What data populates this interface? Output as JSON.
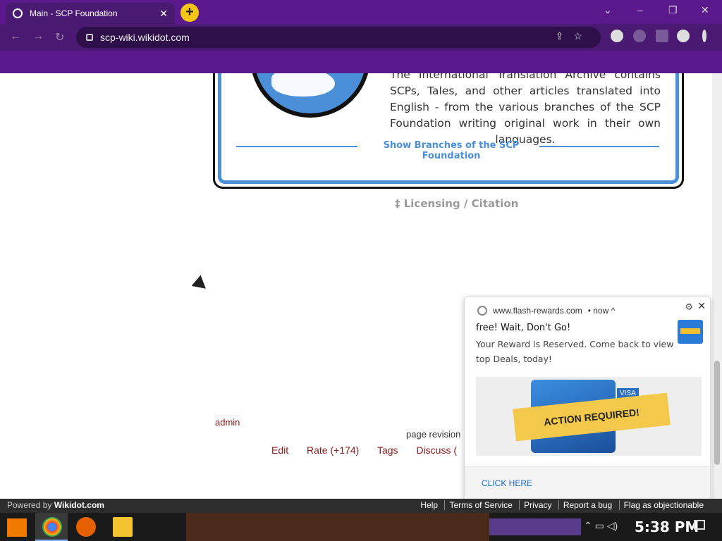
{
  "browser": {
    "tab_title": "Main - SCP Foundation",
    "tab_close": "✕",
    "new_tab": "+",
    "url": "scp-wiki.wikidot.com",
    "controls": {
      "chevron": "⌄",
      "minimize": "–",
      "restore": "❐",
      "close": "✕"
    },
    "nav": {
      "back": "←",
      "forward": "→",
      "reload": "↻"
    }
  },
  "page": {
    "description": "The International Translation Archive contains SCPs, Tales, and other articles translated into English - from the various branches of the SCP Foundation writing original work in their own languages.",
    "branches_link": "Show Branches of the SCP Foundation",
    "licensing": "‡ Licensing / Citation",
    "admin": "admin",
    "revision": "page revision",
    "actions": [
      "Edit",
      "Rate (+174)",
      "Tags",
      "Discuss ("
    ]
  },
  "notification": {
    "source": "www.flash-rewards.com",
    "time": "• now ^",
    "title": "free! Wait, Don't Go!",
    "body": "Your Reward is Reserved. Come back to view top Deals, today!",
    "banner_text": "ACTION REQUIRED!",
    "banner_brand": "VISA",
    "cta": "CLICK HERE",
    "gear": "⚙",
    "close": "✕"
  },
  "wikidot_bar": {
    "powered_by": "Powered by",
    "brand": "Wikidot.com",
    "links": [
      "Help",
      "Terms of Service",
      "Privacy",
      "Report a bug",
      "Flag as objectionable"
    ]
  },
  "taskbar": {
    "time": "5:38 PM"
  }
}
